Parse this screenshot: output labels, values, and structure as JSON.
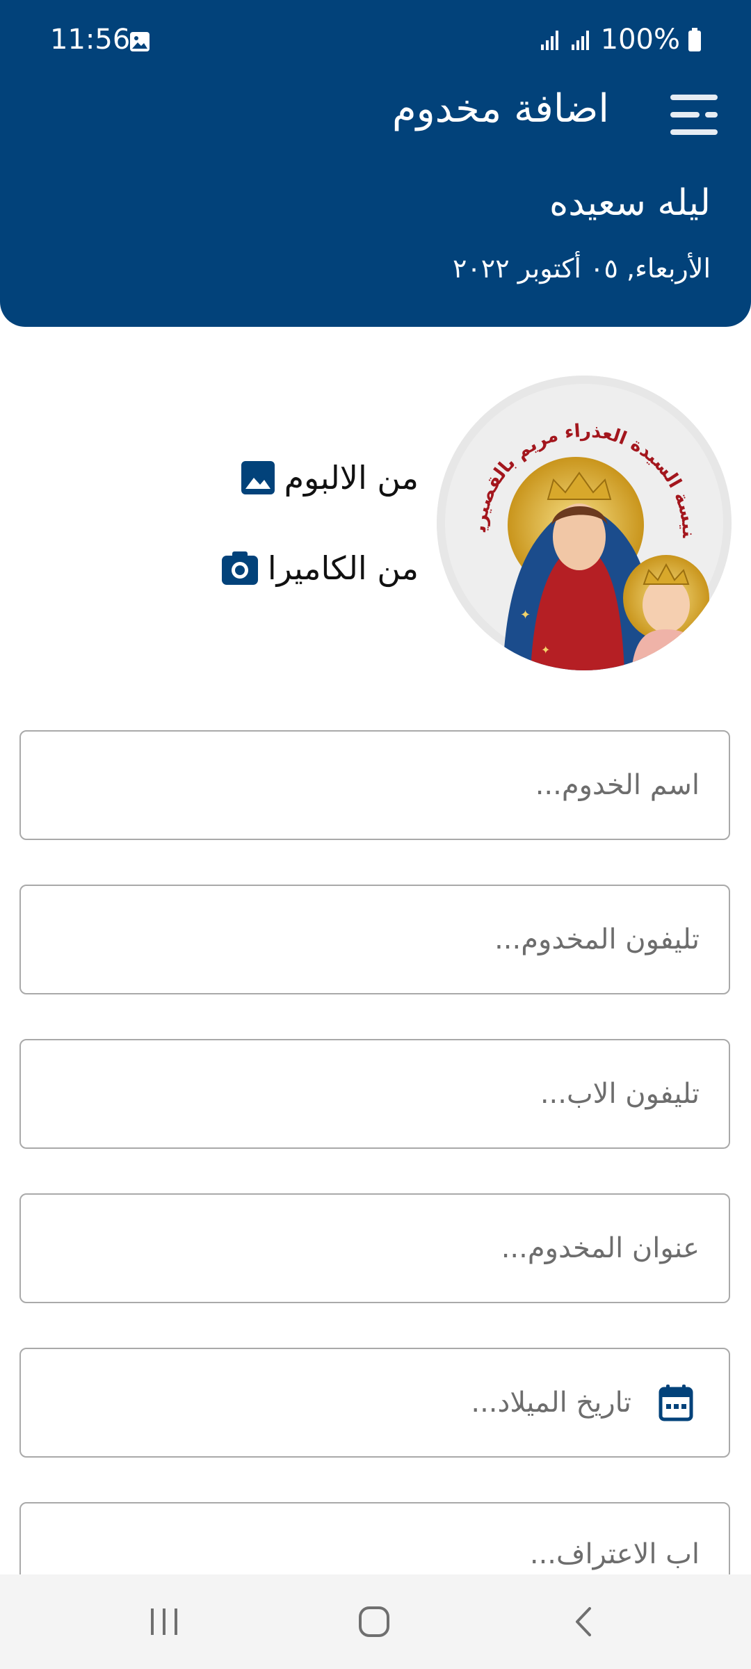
{
  "status_bar": {
    "time": "11:56",
    "battery": "100%"
  },
  "header": {
    "title": "اضافة مخدوم",
    "user_name": "ليله سعيده",
    "date": "الأربعاء, ٠٥ أكتوبر ٢٠٢٢"
  },
  "photo": {
    "logo_text": "كنيسة السيدة العذراء مريم بالقصيرين",
    "from_album": "من الالبوم",
    "from_camera": "من الكاميرا"
  },
  "form": {
    "name_placeholder": "اسم الخدوم...",
    "phone_placeholder": "تليفون المخدوم...",
    "father_phone_placeholder": "تليفون الاب...",
    "address_placeholder": "عنوان المخدوم...",
    "birthdate_placeholder": "تاريخ الميلاد...",
    "confession_father_placeholder": "اب الاعتراف..."
  },
  "colors": {
    "primary": "#02427a",
    "field_border": "#a9a9a9",
    "placeholder": "#6d6d6d",
    "nav_bg": "#f4f4f4"
  },
  "icons": {
    "menu": "menu-icon",
    "album": "image-icon",
    "camera": "camera-icon",
    "calendar": "calendar-icon",
    "nav_recents": "recents-icon",
    "nav_home": "home-icon",
    "nav_back": "back-icon"
  }
}
